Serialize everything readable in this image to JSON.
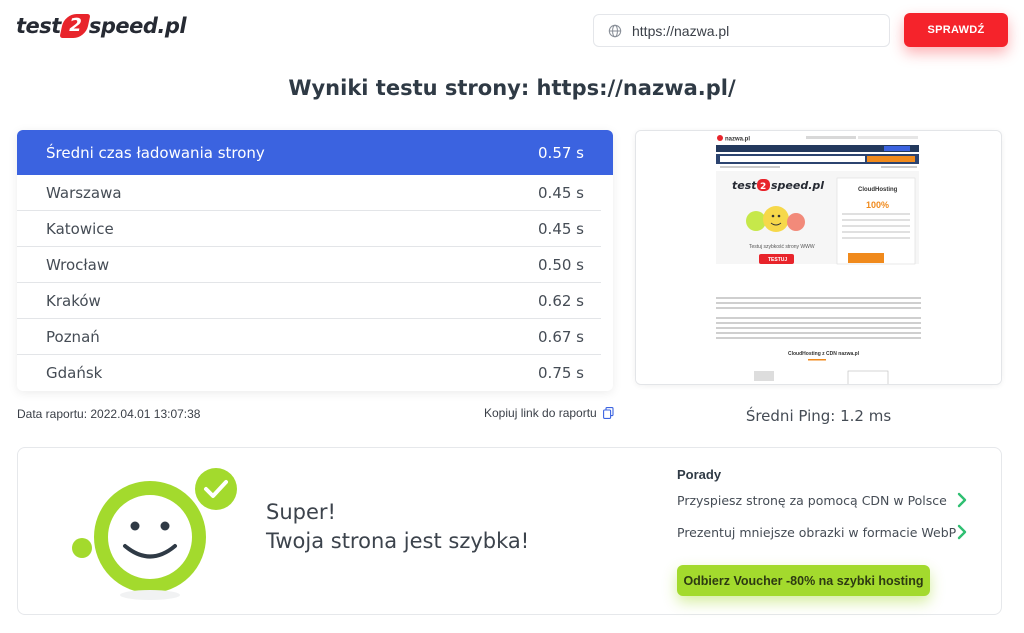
{
  "header": {
    "logo_left": "test",
    "logo_num": "2",
    "logo_right": "speed.pl",
    "url_value": "https://nazwa.pl",
    "check_button": "SPRAWDŹ"
  },
  "page_title": "Wyniki testu strony: https://nazwa.pl/",
  "results": {
    "header_label": "Średni czas ładowania strony",
    "header_value": "0.57 s",
    "rows": [
      {
        "city": "Warszawa",
        "time": "0.45 s"
      },
      {
        "city": "Katowice",
        "time": "0.45 s"
      },
      {
        "city": "Wrocław",
        "time": "0.50 s"
      },
      {
        "city": "Kraków",
        "time": "0.62 s"
      },
      {
        "city": "Poznań",
        "time": "0.67 s"
      },
      {
        "city": "Gdańsk",
        "time": "0.75 s"
      }
    ]
  },
  "report_date": "Data raportu: 2022.04.01 13:07:38",
  "copy_link": "Kopiuj link do raportu",
  "ping": "Średni Ping: 1.2 ms",
  "preview": {
    "site_logo": "nazwa.pl",
    "logo_left": "test",
    "logo_num": "2",
    "logo_right": "speed.pl",
    "test_text": "Testuj szybkość strony WWW",
    "test_button": "TESTUJ",
    "cloud_title": "CloudHosting",
    "cloud_percent": "100%",
    "cdn_heading": "CloudHosting z CDN nazwa.pl"
  },
  "verdict": {
    "line1": "Super!",
    "line2": "Twoja strona jest szybka!"
  },
  "tips": {
    "title": "Porady",
    "items": [
      "Przyspiesz stronę za pomocą CDN w Polsce",
      "Prezentuj mniejsze obrazki w formacie WebP"
    ]
  },
  "voucher_button": "Odbierz Voucher -80% na szybki hosting",
  "colors": {
    "brand_red": "#f5232b",
    "header_blue": "#3b63e0",
    "accent_green": "#a3da2d",
    "chevron_green": "#2fbf71"
  }
}
